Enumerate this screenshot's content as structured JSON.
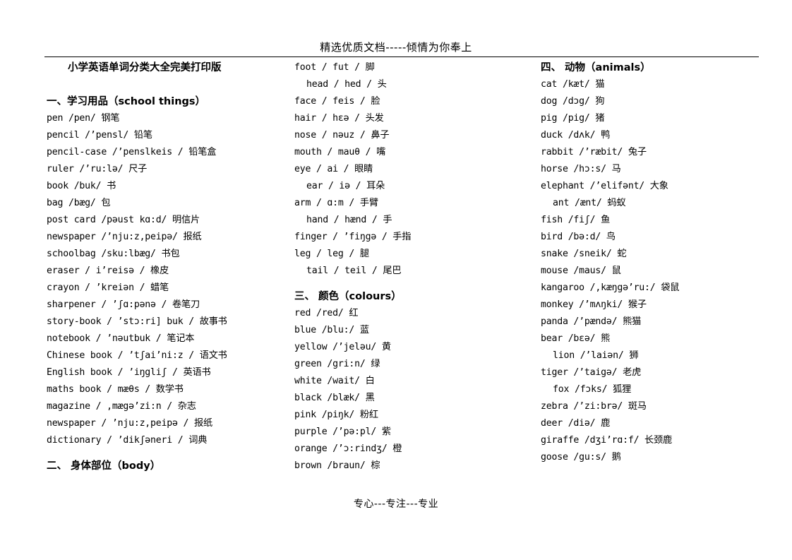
{
  "header": {
    "watermark": "精选优质文档-----倾情为你奉上"
  },
  "footer": {
    "watermark": "专心---专注---专业"
  },
  "document": {
    "title": "小学英语单词分类大全完美打印版"
  },
  "sections": [
    {
      "id": "school-things",
      "number": "一、",
      "title": "学习用品（school things）",
      "column": 1,
      "entries": [
        {
          "text": "pen /pen/ 钢笔",
          "indent": false
        },
        {
          "text": "pencil /’pensl/ 铅笔",
          "indent": false
        },
        {
          "text": "pencil-case /’penslkeis / 铅笔盒",
          "indent": false
        },
        {
          "text": "ruler /’ru:lə/ 尺子",
          "indent": false
        },
        {
          "text": "book /buk/ 书",
          "indent": false
        },
        {
          "text": "bag /bæg/ 包",
          "indent": false
        },
        {
          "text": "post card /pəust kɑ:d/ 明信片",
          "indent": false
        },
        {
          "text": "newspaper /’nju:z,peipə/ 报纸",
          "indent": false
        },
        {
          "text": "schoolbag /sku:lbæg/ 书包",
          "indent": false
        },
        {
          "text": "eraser / i’reisə / 橡皮",
          "indent": false
        },
        {
          "text": "crayon / ’kreiən / 蜡笔",
          "indent": false
        },
        {
          "text": "sharpener / ’ʃɑ:pənə / 卷笔刀",
          "indent": false
        },
        {
          "text": "story-book / ’stɔ:ri] buk / 故事书",
          "indent": false
        },
        {
          "text": "notebook / ’nəutbuk / 笔记本",
          "indent": false
        },
        {
          "text": "Chinese book   / ’tʃai’ni:z / 语文书",
          "indent": false
        },
        {
          "text": "English book / ’iŋgliʃ / 英语书",
          "indent": false
        },
        {
          "text": "maths book   / mæθs / 数学书",
          "indent": false
        },
        {
          "text": "magazine / ,mægə’zi:n / 杂志",
          "indent": false
        },
        {
          "text": "newspaper / ’nju:z,peipə / 报纸",
          "indent": false
        },
        {
          "text": "dictionary / ’dikʃəneri / 词典",
          "indent": false
        }
      ]
    },
    {
      "id": "body",
      "number": "二、",
      "title": "  身体部位（body）",
      "column": 1,
      "entries": []
    },
    {
      "id": "body-words",
      "number": "",
      "title": "",
      "column": 2,
      "entries": [
        {
          "text": "foot / fut / 脚",
          "indent": false
        },
        {
          "text": "head / hed / 头",
          "indent": true
        },
        {
          "text": "face / feis / 脸",
          "indent": false
        },
        {
          "text": "hair / hɛə / 头发",
          "indent": false
        },
        {
          "text": "nose / nəuz / 鼻子",
          "indent": false
        },
        {
          "text": "mouth / mauθ / 嘴",
          "indent": false
        },
        {
          "text": "eye / ai / 眼睛",
          "indent": false
        },
        {
          "text": "ear / iə / 耳朵",
          "indent": true
        },
        {
          "text": "arm / ɑ:m / 手臂",
          "indent": false
        },
        {
          "text": "hand / hænd / 手",
          "indent": true
        },
        {
          "text": "finger / ’fiŋgə / 手指",
          "indent": false
        },
        {
          "text": "leg / leg / 腿",
          "indent": false
        },
        {
          "text": "tail / teil / 尾巴",
          "indent": true
        }
      ]
    },
    {
      "id": "colours",
      "number": "三、",
      "title": "  颜色（colours）",
      "column": 2,
      "entries": [
        {
          "text": "red /red/ 红",
          "indent": false
        },
        {
          "text": "blue /blu:/ 蓝",
          "indent": false
        },
        {
          "text": "yellow /’jeləu/ 黄",
          "indent": false
        },
        {
          "text": "green /gri:n/ 绿",
          "indent": false
        },
        {
          "text": "white /wait/ 白",
          "indent": false
        },
        {
          "text": "black /blæk/ 黑",
          "indent": false
        },
        {
          "text": "pink /piŋk/ 粉红",
          "indent": false
        },
        {
          "text": "purple /’pə:pl/ 紫",
          "indent": false
        },
        {
          "text": "orange /’ɔ:rindʒ/ 橙",
          "indent": false
        },
        {
          "text": "brown /braun/ 棕",
          "indent": false
        }
      ]
    },
    {
      "id": "animals",
      "number": "四、",
      "title": "  动物（animals）",
      "column": 3,
      "entries": [
        {
          "text": "cat /kæt/ 猫",
          "indent": false
        },
        {
          "text": "dog /dɔg/ 狗",
          "indent": false
        },
        {
          "text": "pig /pig/ 猪",
          "indent": false
        },
        {
          "text": "duck /dʌk/ 鸭",
          "indent": false
        },
        {
          "text": "rabbit /’ræbit/ 兔子",
          "indent": false
        },
        {
          "text": "horse /hɔ:s/ 马",
          "indent": false
        },
        {
          "text": "elephant /’elifənt/ 大象",
          "indent": false
        },
        {
          "text": "ant /ænt/ 蚂蚁",
          "indent": true
        },
        {
          "text": "fish /fiʃ/ 鱼",
          "indent": false
        },
        {
          "text": "bird /bə:d/ 鸟",
          "indent": false
        },
        {
          "text": "snake /sneik/ 蛇",
          "indent": false
        },
        {
          "text": "mouse /maus/ 鼠",
          "indent": false
        },
        {
          "text": "kangaroo /,kæŋgə’ru:/ 袋鼠",
          "indent": false
        },
        {
          "text": "monkey /’mʌŋki/ 猴子",
          "indent": false
        },
        {
          "text": "panda /’pændə/ 熊猫",
          "indent": false
        },
        {
          "text": "bear /bɛə/ 熊",
          "indent": false
        },
        {
          "text": "lion /’laiən/ 狮",
          "indent": true
        },
        {
          "text": "tiger /’taigə/ 老虎",
          "indent": false
        },
        {
          "text": "fox   /fɔks/ 狐狸",
          "indent": true
        },
        {
          "text": "zebra /’zi:brə/ 斑马",
          "indent": false
        },
        {
          "text": "deer /diə/ 鹿",
          "indent": false
        },
        {
          "text": "giraffe /dʒi’rɑ:f/ 长颈鹿",
          "indent": false
        },
        {
          "text": "goose /gu:s/ 鹅",
          "indent": false
        }
      ]
    }
  ]
}
